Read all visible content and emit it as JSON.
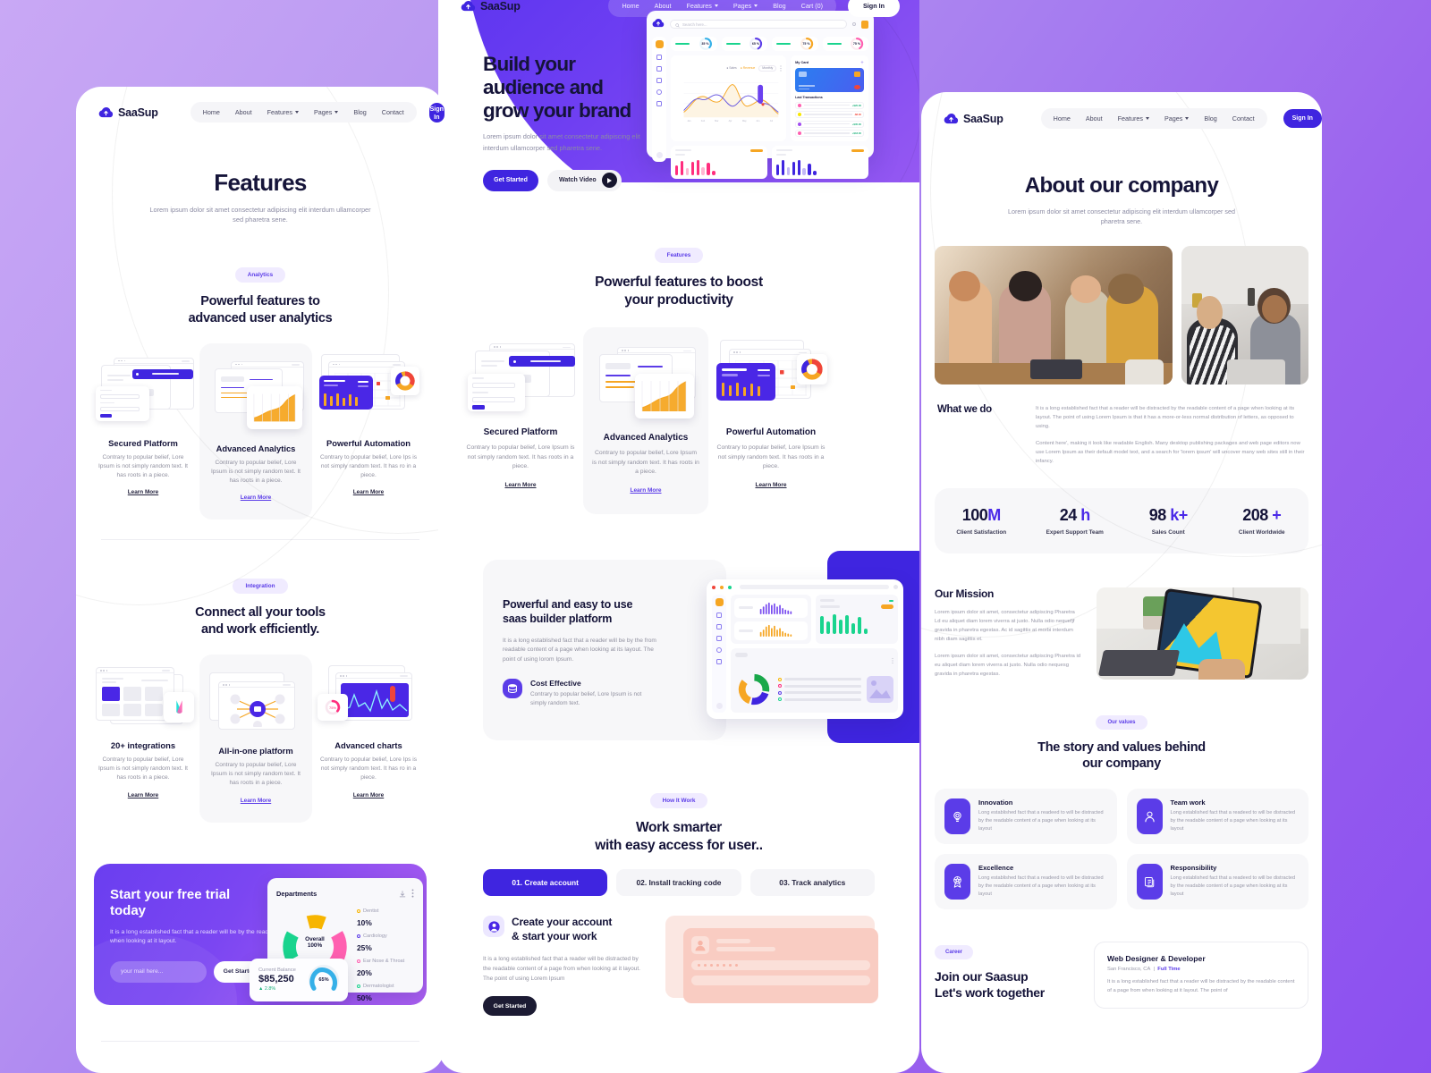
{
  "brand": {
    "name": "SaaSup",
    "logo_icon": "cloud-upload-icon"
  },
  "nav": {
    "items_left_panel": [
      "Home",
      "About",
      "Features",
      "Pages",
      "Blog",
      "Contact"
    ],
    "items_center_panel": [
      "Home",
      "About",
      "Features",
      "Pages",
      "Blog",
      "Cart (0)"
    ],
    "items_right_panel": [
      "Home",
      "About",
      "Features",
      "Pages",
      "Blog",
      "Contact"
    ],
    "signin_label": "Sign In"
  },
  "features_page": {
    "title": "Features",
    "subtitle": "Lorem ipsum dolor sit amet consectetur adipiscing elit interdum ullamcorper sed pharetra sene.",
    "section_analytics": {
      "badge": "Analytics",
      "heading_line1": "Powerful features to",
      "heading_line2": "advanced user analytics",
      "cards": [
        {
          "title": "Secured Platform",
          "desc": "Contrary to popular belief, Lore Ipsum is not simply random text. It has roots in a piece.",
          "link": "Learn More",
          "icon": "secure-login-mockup-icon"
        },
        {
          "title": "Advanced Analytics",
          "desc": "Contrary to popular belief, Lore Ipsum is not simply random text. It has roots in a piece.",
          "link": "Learn More",
          "icon": "analytics-chart-mockup-icon"
        },
        {
          "title": "Powerful Automation",
          "desc": "Contrary to popular belief, Lore Ips is not simply random text. It has ro in a piece.",
          "link": "Learn More",
          "icon": "automation-dashboard-mockup-icon"
        }
      ]
    },
    "section_integration": {
      "badge": "Integration",
      "heading_line1": "Connect all your tools",
      "heading_line2": "and work efficiently.",
      "cards": [
        {
          "title": "20+ integrations",
          "desc": "Contrary to popular belief, Lore Ipsum is not simply random text. It has roots in a piece.",
          "link": "Learn More",
          "icon": "integration-grid-mockup-icon"
        },
        {
          "title": "All-in-one platform",
          "desc": "Contrary to popular belief, Lore Ipsum is not simply random text. It has roots in a piece.",
          "link": "Learn More",
          "icon": "hub-network-mockup-icon"
        },
        {
          "title": "Advanced charts",
          "desc": "Contrary to popular belief, Lore Ips is not simply random text. It has ro in a piece.",
          "link": "Learn More",
          "icon": "line-chart-mockup-icon"
        }
      ]
    },
    "trial": {
      "heading_line1": "Start your free trial",
      "heading_line2": "today",
      "desc": "It is a long established fact that a reader will be by the readable when looking at it layout.",
      "input_placeholder": "your mail here...",
      "button": "Get Started",
      "widget": {
        "title": "Departments",
        "center_label": "Overall",
        "center_value": "100%",
        "legend": [
          {
            "label": "Dentist",
            "value": "10%",
            "color": "#f7b500"
          },
          {
            "label": "Cardiology",
            "value": "25%",
            "color": "#5b3ce8"
          },
          {
            "label": "Ear Nose & Throat",
            "value": "20%",
            "color": "#ff5fb0"
          },
          {
            "label": "Dermatologist",
            "value": "50%",
            "color": "#19d48e"
          }
        ],
        "balance_label": "Current Balance",
        "balance_value": "$85,250",
        "balance_delta": "2.8%",
        "balance_gauge": "65%"
      }
    }
  },
  "home_page": {
    "hero": {
      "heading_line1": "Build your",
      "heading_line2": "audience and",
      "heading_line3": "grow your brand",
      "subtitle": "Lorem ipsum dolor sit amet consectetur adipiscing elit interdum ullamcorper sed pharetra sene.",
      "primary_button": "Get Started",
      "secondary_button": "Watch Video",
      "dashboard": {
        "search_placeholder": "Search here...",
        "gauges": [
          "35 %",
          "65 %",
          "75 %",
          "75 %"
        ],
        "card_label": "My Card",
        "transactions_label": "Last Transactions"
      }
    },
    "section_features": {
      "badge": "Features",
      "heading_line1": "Powerful features to boost",
      "heading_line2": "your productivity",
      "cards": [
        {
          "title": "Secured Platform",
          "desc": "Contrary to popular belief, Lore Ipsum is not simply random text. It has roots in a piece.",
          "link": "Learn More",
          "icon": "secure-login-mockup-icon"
        },
        {
          "title": "Advanced Analytics",
          "desc": "Contrary to popular belief, Lore Ipsum is not simply random text. It has roots in a piece.",
          "link": "Learn More",
          "icon": "analytics-chart-mockup-icon"
        },
        {
          "title": "Powerful Automation",
          "desc": "Contrary to popular belief, Lore Ipsum is not simply random text. It has roots in a piece.",
          "link": "Learn More",
          "icon": "automation-dashboard-mockup-icon"
        }
      ]
    },
    "section_builder": {
      "heading_line1": "Powerful and easy to use",
      "heading_line2": "saas builder platform",
      "desc": "It is a long established fact that a reader will be by the from readable content of a page when looking at its layout. The point of using lorom Ipsum.",
      "feature_title": "Cost Effective",
      "feature_desc": "Contrary to popular belief, Lore Ipsum is not simply random text.",
      "feature_icon": "database-stack-icon"
    },
    "section_how": {
      "badge": "How It Work",
      "heading_line1": "Work smarter",
      "heading_line2": "with easy access for user..",
      "steps": [
        "01. Create account",
        "02. Install tracking code",
        "03. Track analytics"
      ],
      "active_step_index": 0,
      "panel": {
        "icon": "user-avatar-icon",
        "title_line1": "Create your account",
        "title_line2": "& start your work",
        "desc": "It is a long established fact that a reader will be distracted by the readable content of a page from when looking at it layout. The point of using Lorem Ipsum",
        "button": "Get Started"
      }
    }
  },
  "about_page": {
    "title": "About our company",
    "subtitle": "Lorem ipsum dolor sit amet consectetur adipiscing elit interdum ullamcorper sed pharetra sene.",
    "what_we_do": {
      "heading": "What we do",
      "p1": "It is a long established fact that a reader will be distracted by the readable content of a page when looking at its layout. The point of using Lorem Ipsum is that it has a more-or-less normal distribution of letters, as opposed to using.",
      "p2": "Content here', making it look like readable English. Many desktop publishing packages and web page editors now use Lorem Ipsum as their default model text, and a search for 'lorem ipsum' will uncover many web sites still in their infancy."
    },
    "stats": [
      {
        "value": "100",
        "suffix": "M",
        "label": "Client Satisfaction"
      },
      {
        "value": "24",
        "suffix": "h",
        "label": "Expert Support Team"
      },
      {
        "value": "98",
        "suffix": "k+",
        "label": "Sales Count"
      },
      {
        "value": "208",
        "suffix": "+",
        "label": "Client Worldwide"
      }
    ],
    "mission": {
      "heading": "Our Mission",
      "p1": "Lorem ipsum dolor sit amet, consectetur adipiscing Pharetra Ld eu aliquet diam lorem viverra at justo. Nulla odio nequefjf gravida in pharetra egestas. Ac id sagittis at morbi interdum nibh diam sagittis et.",
      "p2": "Lorem ipsum dolor sit amet, consectetur adipiscing Pharetra id eu aliquet diam lorem viverra at justo. Nulla odio nequesg gravida in pharetra egestas."
    },
    "values": {
      "badge": "Our values",
      "heading_line1": "The story and values behind",
      "heading_line2": "our company",
      "cards": [
        {
          "title": "Innovation",
          "desc": "Long established fact that a readeed to will be distracted by the readable content of a page when looking at its layout",
          "icon": "lightbulb-icon"
        },
        {
          "title": "Team work",
          "desc": "Long established fact that a readeed to will be distracted by the readable content of a page when looking at its layout",
          "icon": "user-group-icon"
        },
        {
          "title": "Excellence",
          "desc": "Long established fact that a readeed to will be distracted by the readable content of a page when looking at its layout",
          "icon": "award-ribbon-icon"
        },
        {
          "title": "Responsibility",
          "desc": "Long established fact that a readeed to will be distracted by the readable content of a page when looking at its layout",
          "icon": "documents-icon"
        }
      ]
    },
    "career": {
      "badge": "Career",
      "heading_line1": "Join our Saasup",
      "heading_line2": "Let's work together",
      "job": {
        "title": "Web Designer & Developer",
        "location": "San Francisco, CA",
        "type": "Full Time",
        "desc": "It is a long established fact that a reader will be distracted by the readable content of a page from when looking at it layout. The point of"
      }
    }
  },
  "colors": {
    "accent": "#3f25e0",
    "accent_light": "#5b3ce8",
    "ink": "#151439",
    "muted": "#9898a8",
    "bg_purple": "#a77ef0"
  }
}
